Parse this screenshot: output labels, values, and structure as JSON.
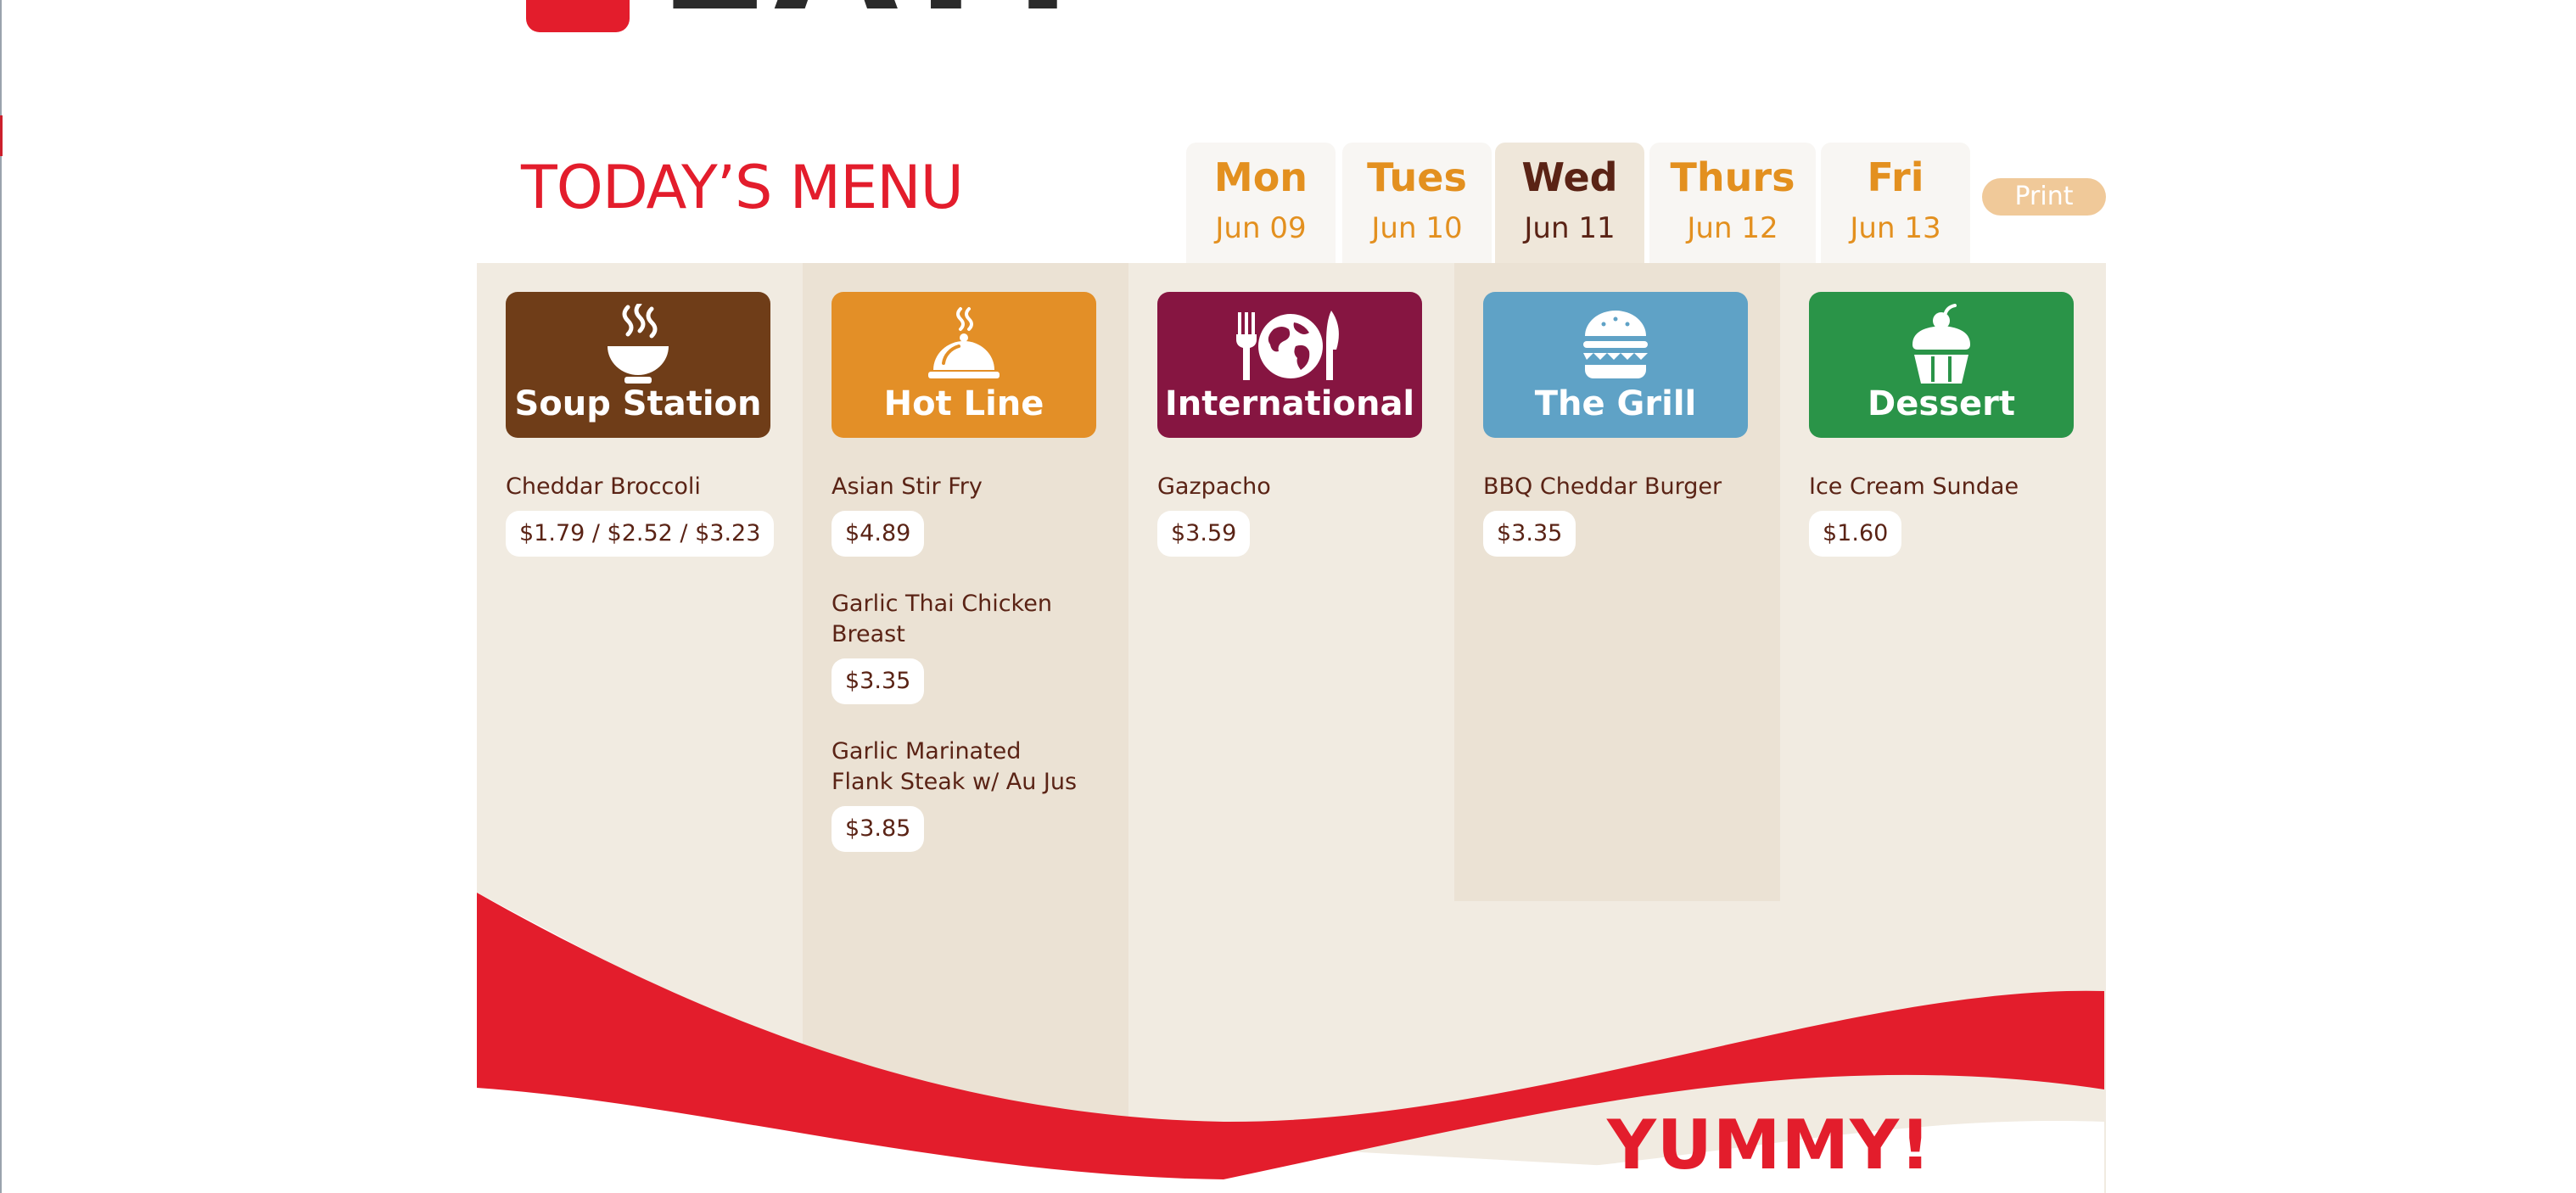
{
  "logo": {
    "text": "EAT!"
  },
  "title": "TODAY’S MENU",
  "days": [
    {
      "day": "Mon",
      "date": "Jun 09",
      "active": false
    },
    {
      "day": "Tues",
      "date": "Jun 10",
      "active": false
    },
    {
      "day": "Wed",
      "date": "Jun 11",
      "active": true
    },
    {
      "day": "Thurs",
      "date": "Jun 12",
      "active": false
    },
    {
      "day": "Fri",
      "date": "Jun 13",
      "active": false
    }
  ],
  "print_label": "Print",
  "stations": [
    {
      "name": "Soup Station",
      "icon": "soup-bowl-icon",
      "color": "#6f3d18",
      "items": [
        {
          "name": "Cheddar Broccoli",
          "price": "$1.79 / $2.52 / $3.23"
        }
      ]
    },
    {
      "name": "Hot Line",
      "icon": "cloche-icon",
      "color": "#e38f27",
      "items": [
        {
          "name": "Asian Stir Fry",
          "price": "$4.89"
        },
        {
          "name": "Garlic Thai Chicken Breast",
          "price": "$3.35"
        },
        {
          "name": "Garlic Marinated Flank Steak w/ Au Jus",
          "price": "$3.85"
        }
      ]
    },
    {
      "name": "International",
      "icon": "globe-fork-knife-icon",
      "color": "#861541",
      "items": [
        {
          "name": "Gazpacho",
          "price": "$3.59"
        }
      ]
    },
    {
      "name": "The Grill",
      "icon": "burger-icon",
      "color": "#5fa2c6",
      "items": [
        {
          "name": "BBQ Cheddar Burger",
          "price": "$3.35"
        }
      ]
    },
    {
      "name": "Dessert",
      "icon": "cupcake-icon",
      "color": "#2a9448",
      "items": [
        {
          "name": "Ice Cream Sundae",
          "price": "$1.60"
        }
      ]
    }
  ],
  "footer_text": "YUMMY!",
  "colors": {
    "brand_red": "#e31d2c",
    "tab_accent": "#e3901f",
    "text_brown": "#5a2315",
    "panel_bg": "#f1ebe1"
  }
}
